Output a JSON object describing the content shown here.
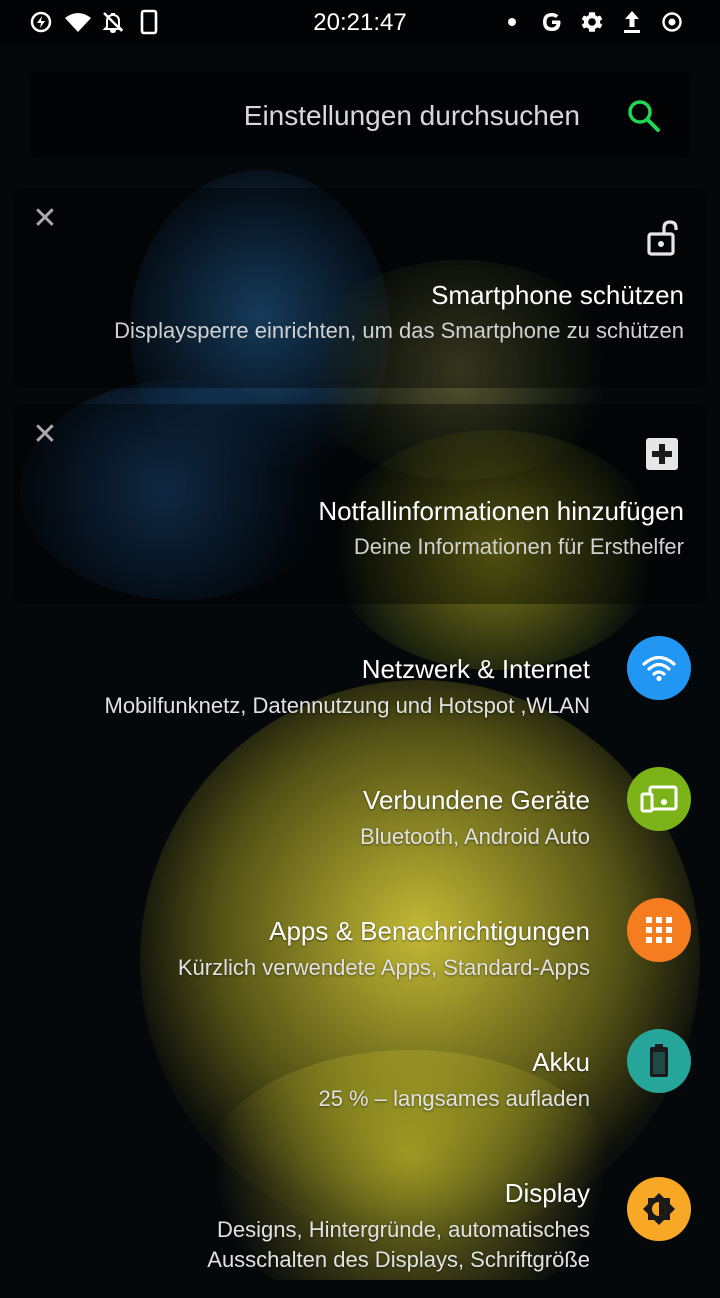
{
  "status_bar": {
    "time": "20:21:47",
    "icons_left": [
      "data-saver-icon",
      "wifi-icon",
      "notifications-off-icon",
      "phone-icon"
    ],
    "icons_right": [
      "dot-icon",
      "google-icon",
      "gear-icon",
      "upload-icon",
      "record-icon"
    ]
  },
  "search": {
    "placeholder": "Einstellungen durchsuchen"
  },
  "suggestions": [
    {
      "title": "Smartphone schützen",
      "subtitle": "Displaysperre einrichten, um das Smartphone zu schützen",
      "icon": "unlock-icon"
    },
    {
      "title": "Notfallinformationen hinzufügen",
      "subtitle": "Deine Informationen für Ersthelfer",
      "icon": "medical-plus-icon"
    }
  ],
  "settings": [
    {
      "title": "Netzwerk & Internet",
      "subtitle": "Mobilfunknetz, Datennutzung und Hotspot ,WLAN",
      "icon": "wifi-icon",
      "color": "#2196f3"
    },
    {
      "title": "Verbundene Geräte",
      "subtitle": "Bluetooth, Android Auto",
      "icon": "devices-icon",
      "color": "#7cb319"
    },
    {
      "title": "Apps & Benachrichtigungen",
      "subtitle": "Kürzlich verwendete Apps, Standard-Apps",
      "icon": "apps-grid-icon",
      "color": "#f57c1f"
    },
    {
      "title": "Akku",
      "subtitle": "25 % – langsames aufladen",
      "icon": "battery-icon",
      "color": "#26a69a"
    },
    {
      "title": "Display",
      "subtitle": "Designs, Hintergründe, automatisches\nAusschalten des Displays, Schriftgröße",
      "icon": "brightness-icon",
      "color": "#f9a825"
    }
  ]
}
